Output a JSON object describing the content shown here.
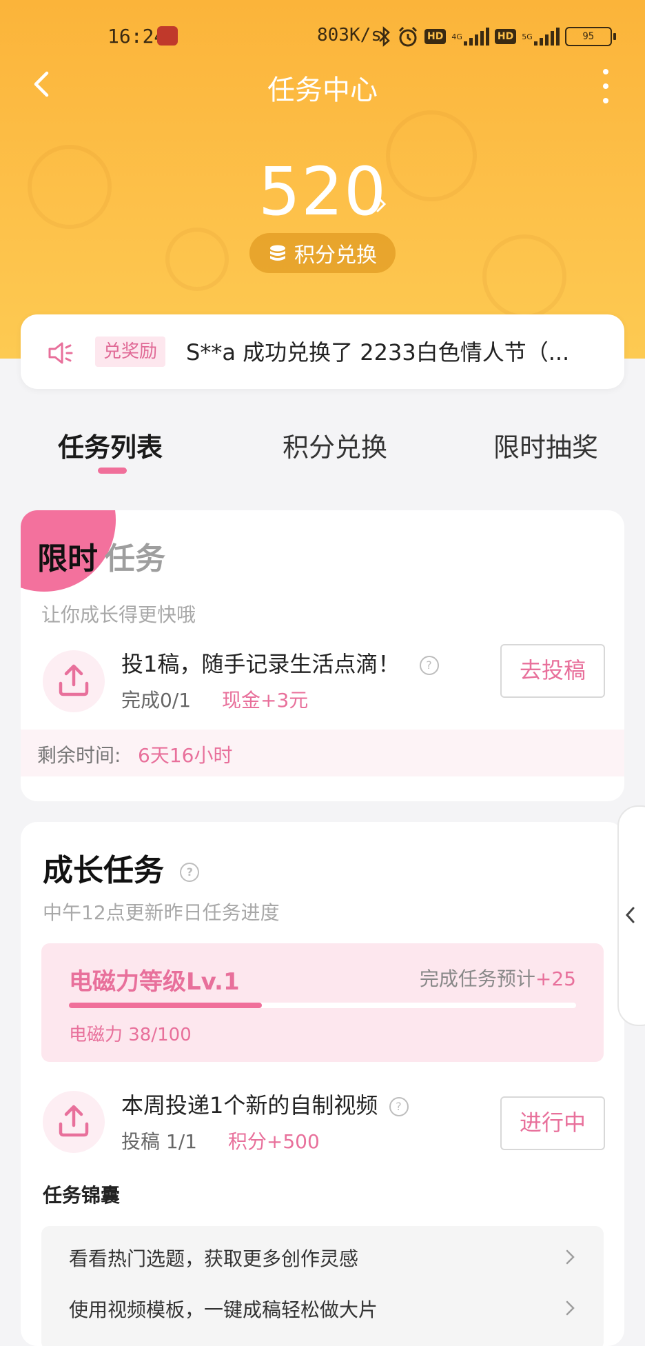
{
  "status_bar": {
    "time": "16:24",
    "net_speed": "803K/s",
    "hd_label": "HD",
    "net_4g": "4G",
    "net_5g": "5G",
    "battery": "95"
  },
  "nav": {
    "title": "任务中心"
  },
  "header": {
    "points": "520",
    "exchange_button": "积分兑换"
  },
  "notice": {
    "tag": "兑奖励",
    "text": "S**a 成功兑换了 2233白色情人节（..."
  },
  "tabs": [
    {
      "label": "任务列表",
      "active": true
    },
    {
      "label": "积分兑换",
      "active": false
    },
    {
      "label": "限时抽奖",
      "active": false
    }
  ],
  "limited_task": {
    "badge": "限时",
    "title_suffix": "任务",
    "subtitle": "让你成长得更快哦",
    "task": {
      "title": "投1稿，随手记录生活点滴！",
      "progress": "完成0/1",
      "reward": "现金+3元",
      "button": "去投稿"
    },
    "remaining_label": "剩余时间:",
    "remaining_value": "6天16小时"
  },
  "growth_task": {
    "title": "成长任务",
    "subtitle": "中午12点更新昨日任务进度",
    "level_box": {
      "level": "电磁力等级Lv.1",
      "estimate_label": "完成任务预计",
      "estimate_value": "+25",
      "power_text": "电磁力 38/100",
      "progress": 0.38
    },
    "task": {
      "title": "本周投递1个新的自制视频",
      "progress": "投稿 1/1",
      "reward": "积分+500",
      "button": "进行中"
    },
    "tips_title": "任务锦囊",
    "tips": [
      "看看热门选题，获取更多创作灵感",
      "使用视频模板，一键成稿轻松做大片"
    ]
  },
  "colors": {
    "header_orange": "#fdc049",
    "accent_pink": "#e8709b",
    "level_box_bg": "#fde7ee"
  }
}
